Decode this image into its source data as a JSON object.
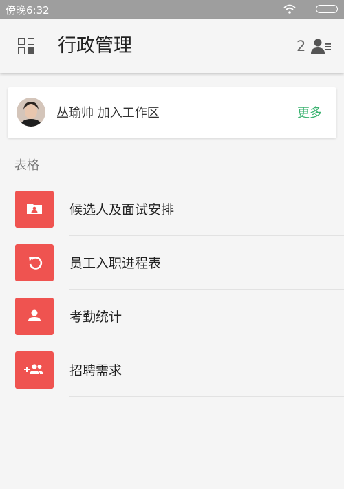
{
  "status_bar": {
    "time": "傍晚6:32"
  },
  "header": {
    "title": "行政管理",
    "member_count": "2"
  },
  "activity": {
    "text": "丛瑜帅 加入工作区",
    "more_label": "更多"
  },
  "section": {
    "title": "表格"
  },
  "forms": [
    {
      "label": "候选人及面试安排",
      "icon": "folder-person-icon"
    },
    {
      "label": "员工入职进程表",
      "icon": "restore-icon"
    },
    {
      "label": "考勤统计",
      "icon": "person-icon"
    },
    {
      "label": "招聘需求",
      "icon": "group-add-icon"
    }
  ],
  "colors": {
    "accent": "#ef5350",
    "link": "#3cb371",
    "status_bar": "#9e9e9e"
  }
}
